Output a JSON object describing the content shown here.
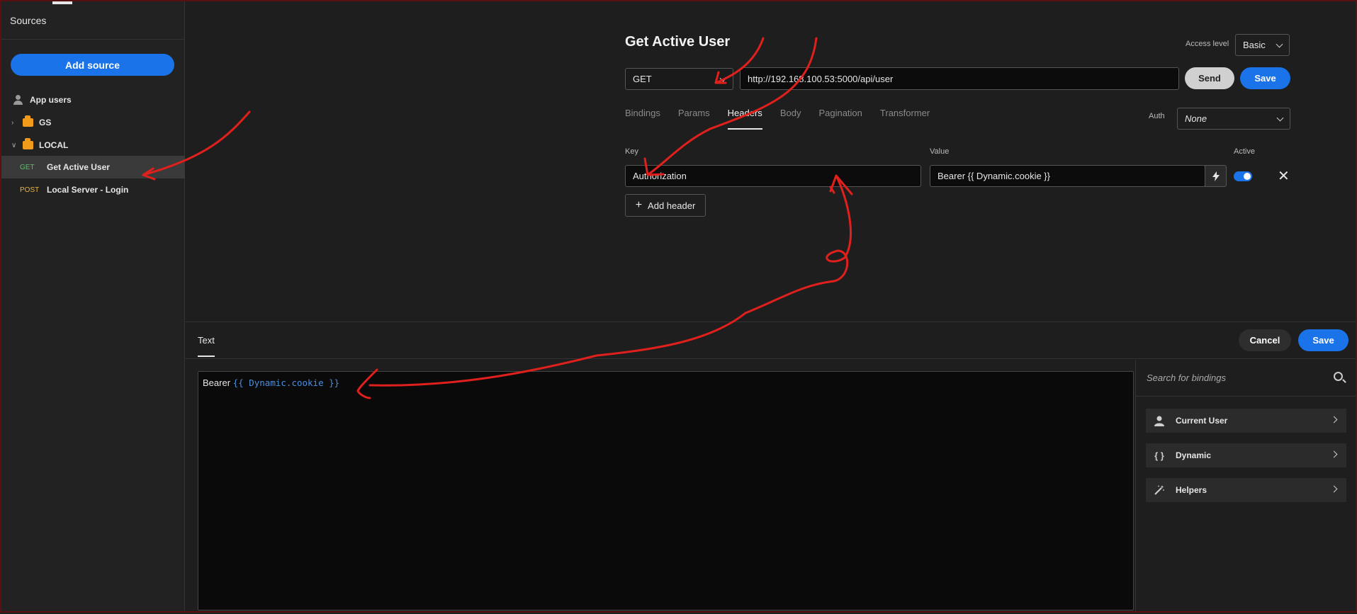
{
  "sidebar": {
    "title": "Sources",
    "add_source_label": "Add source",
    "items": [
      {
        "label": "App users",
        "kind": "user-group"
      },
      {
        "label": "GS",
        "kind": "folder",
        "expanded": false
      },
      {
        "label": "LOCAL",
        "kind": "folder",
        "expanded": true
      },
      {
        "label": "Get Active User",
        "method": "GET",
        "selected": true
      },
      {
        "label": "Local Server - Login",
        "method": "POST",
        "selected": false
      }
    ]
  },
  "request": {
    "title": "Get Active User",
    "access_level_label": "Access level",
    "access_level_value": "Basic",
    "method": "GET",
    "url": "http://192.168.100.53:5000/api/user",
    "send_label": "Send",
    "save_label": "Save",
    "tabs": [
      "Bindings",
      "Params",
      "Headers",
      "Body",
      "Pagination",
      "Transformer"
    ],
    "active_tab": "Headers",
    "auth_label": "Auth",
    "auth_value": "None",
    "headers": {
      "key_label": "Key",
      "value_label": "Value",
      "active_label": "Active",
      "rows": [
        {
          "key": "Authorization",
          "value": "Bearer {{ Dynamic.cookie }}",
          "active": true
        }
      ],
      "add_header_label": "Add header"
    }
  },
  "editor": {
    "tab_label": "Text",
    "cancel_label": "Cancel",
    "save_label": "Save",
    "text_prefix": "Bearer",
    "text_binding": "{{ Dynamic.cookie }}",
    "search_placeholder": "Search for bindings",
    "binding_groups": [
      {
        "label": "Current User",
        "icon": "user-icon"
      },
      {
        "label": "Dynamic",
        "icon": "braces-icon"
      },
      {
        "label": "Helpers",
        "icon": "magic-wand-icon"
      }
    ]
  },
  "colors": {
    "accent": "#1a73e8",
    "annotation": "#e0201c",
    "get_method": "#5fbf6a",
    "post_method": "#e8b43a",
    "binding_text": "#4a90e2"
  }
}
